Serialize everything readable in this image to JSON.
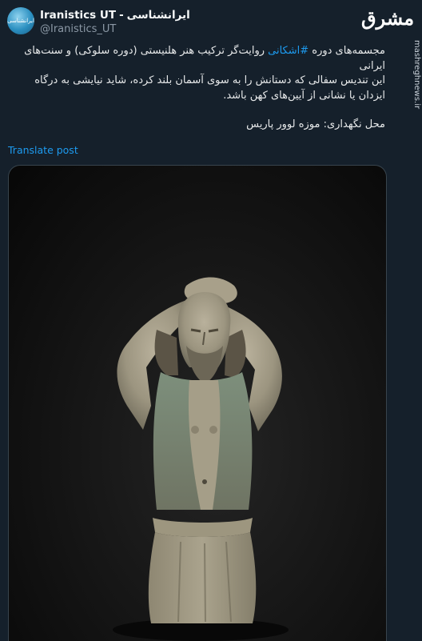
{
  "author": {
    "avatar_text": "ایرانشناسی",
    "display_name": "Iranistics UT",
    "separator": "-",
    "display_name_fa": "ایرانشناسی",
    "handle": "@Iranistics_UT"
  },
  "watermark": {
    "logo_text": "مشرق",
    "site": "mashreghnews.ir"
  },
  "tweet": {
    "line1_before": "مجسمه‌های دوره ",
    "hashtag": "#اشکانی",
    "line1_after": " روایت‌گر ترکیب هنر هلنیستی (دوره سلوکی) و سنت‌های ایرانی",
    "line2": "این تندیس سفالی که دستانش را به سوی آسمان بلند کرده، شاید نیایشی به درگاه ایزدان یا نشانی از آیین‌های کهن باشد.",
    "line3": "محل نگهداری: موزه لوور پاریس"
  },
  "translate_label": "Translate post",
  "media": {
    "icon": "statue-photo"
  }
}
